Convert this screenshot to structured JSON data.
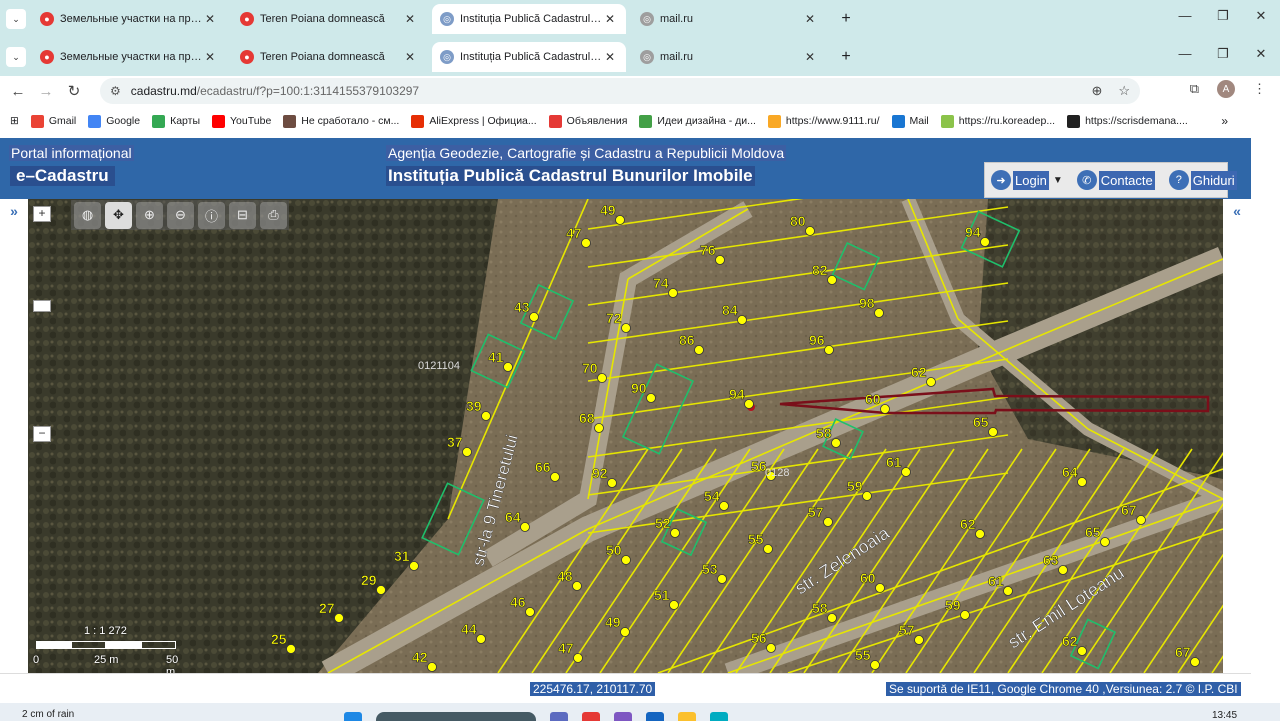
{
  "browser": {
    "tabs": [
      {
        "title": "Земельные участки на продаж",
        "active": false,
        "favicon_color": "#e53935"
      },
      {
        "title": "Teren Poiana domnească",
        "active": false,
        "favicon_color": "#e53935"
      },
      {
        "title": "Instituția Publică Cadastrul Bunu",
        "active": true,
        "favicon_color": "#7e9cc7"
      },
      {
        "title": "mail.ru",
        "active": false,
        "favicon_color": "#9e9e9e"
      }
    ],
    "new_tab_label": "+",
    "close_glyph": "✕",
    "url_host": "cadastru.md",
    "url_path": "/ecadastru/f?p=100:1:3114155379103297",
    "avatar_letter": "A",
    "bookmarks": [
      {
        "label": "Gmail",
        "icon": "gmail-icon",
        "color": "#ea4335"
      },
      {
        "label": "Google",
        "icon": "google-icon",
        "color": "#4285f4"
      },
      {
        "label": "Карты",
        "icon": "maps-icon",
        "color": "#34a853"
      },
      {
        "label": "YouTube",
        "icon": "youtube-icon",
        "color": "#ff0000"
      },
      {
        "label": "Не сработало - см...",
        "icon": "page-icon",
        "color": "#6d4c41"
      },
      {
        "label": "AliExpress | Официа...",
        "icon": "aliexpress-icon",
        "color": "#e62e04"
      },
      {
        "label": "Объявления",
        "icon": "ads-icon",
        "color": "#e53935"
      },
      {
        "label": "Идеи дизайна - ди...",
        "icon": "design-icon",
        "color": "#43a047"
      },
      {
        "label": "https://www.9111.ru/",
        "icon": "shield-icon",
        "color": "#f9a825"
      },
      {
        "label": "Mail",
        "icon": "mail-icon",
        "color": "#1976d2"
      },
      {
        "label": "https://ru.koreadep...",
        "icon": "people-icon",
        "color": "#8bc34a"
      },
      {
        "label": "https://scrisdemana....",
        "icon": "s-icon",
        "color": "#212121"
      }
    ]
  },
  "site": {
    "portal_line1": "Portal informațional",
    "portal_line2": "e–Cadastru",
    "agency_line1": "Agenția Geodezie, Cartografie și Cadastru a Republicii Moldova",
    "agency_line2": "Instituția Publică Cadastrul Bunurilor Imobile",
    "login_label": "Login",
    "contacts_label": "Contacte",
    "guides_label": "Ghiduri"
  },
  "map": {
    "zoom_in": "+",
    "zoom_out": "−",
    "sector_code": "0121104",
    "sector_code_2": "0128",
    "streets": [
      "str-la 9 Tineretului",
      "str. Zelenoaia",
      "str. Emil Loteanu"
    ],
    "scale_label": "1 : 1 272",
    "scale_ticks": [
      "0",
      "25 m",
      "50 m"
    ],
    "parcel_numbers": [
      "49",
      "47",
      "80",
      "94",
      "76",
      "82",
      "43",
      "74",
      "98",
      "84",
      "72",
      "41",
      "86",
      "96",
      "70",
      "90",
      "94",
      "62",
      "39",
      "60",
      "68",
      "65",
      "37",
      "58",
      "66",
      "56",
      "61",
      "92",
      "64",
      "54",
      "59",
      "57",
      "64",
      "52",
      "62",
      "67",
      "55",
      "50",
      "65",
      "31",
      "53",
      "63",
      "48",
      "60",
      "29",
      "51",
      "61",
      "46",
      "58",
      "27",
      "49",
      "59",
      "44",
      "57",
      "25",
      "47",
      "56",
      "62",
      "42",
      "55",
      "67"
    ]
  },
  "status": {
    "coordinates": "225476.17, 210117.70",
    "support_text": "Se suportă de IE11, Google Chrome 40 ,Versiunea: 2.7 © I.P. CBI"
  },
  "taskbar": {
    "weather": "2 cm of rain",
    "time": "13:45"
  }
}
